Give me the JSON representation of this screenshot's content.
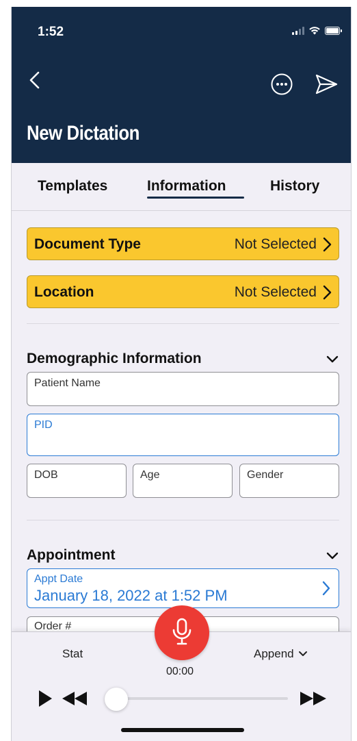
{
  "status_bar": {
    "time": "1:52"
  },
  "nav": {
    "title": "New Dictation",
    "back_icon": "chevron-left-icon",
    "more_icon": "ellipsis-circle-icon",
    "send_icon": "paper-plane-icon"
  },
  "tabs": [
    {
      "label": "Templates",
      "selected": false
    },
    {
      "label": "Information",
      "selected": true
    },
    {
      "label": "History",
      "selected": false
    }
  ],
  "selectors": {
    "document_type": {
      "label": "Document Type",
      "value": "Not Selected"
    },
    "location": {
      "label": "Location",
      "value": "Not Selected"
    }
  },
  "demographic": {
    "title": "Demographic Information",
    "patient_name": {
      "label": "Patient Name",
      "value": ""
    },
    "pid": {
      "label": "PID",
      "value": ""
    },
    "dob": {
      "label": "DOB",
      "value": ""
    },
    "age": {
      "label": "Age",
      "value": ""
    },
    "gender": {
      "label": "Gender",
      "value": ""
    }
  },
  "appointment": {
    "title": "Appointment",
    "appt_date": {
      "label": "Appt Date",
      "value": "January 18, 2022 at 1:52 PM"
    },
    "order": {
      "label": "Order #",
      "value": ""
    }
  },
  "player": {
    "stat_label": "Stat",
    "append_label": "Append",
    "timer": "00:00",
    "progress": 0
  },
  "colors": {
    "header_bg": "#142b47",
    "selector_bg": "#fac72e",
    "active_blue": "#2a7ad4",
    "record_red": "#ec3b34"
  }
}
